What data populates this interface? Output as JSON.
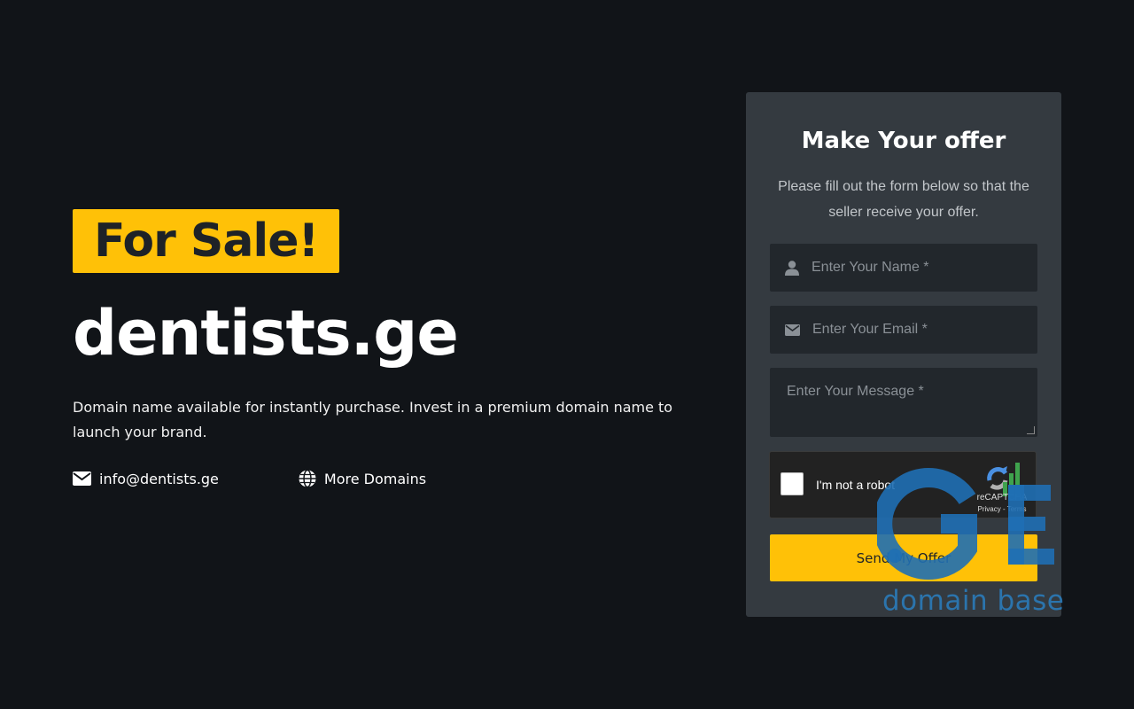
{
  "hero": {
    "badge": "For Sale!",
    "domain": "dentists.ge",
    "description": "Domain name available for instantly purchase. Invest in a premium domain name to launch your brand.",
    "email_link": "info@dentists.ge",
    "more_domains_link": "More Domains"
  },
  "offer_form": {
    "title": "Make Your offer",
    "subtitle": "Please fill out the form below so that the seller receive your offer.",
    "name_placeholder": "Enter Your Name *",
    "email_placeholder": "Enter Your Email *",
    "message_placeholder": "Enter Your Message *",
    "captcha": {
      "label": "I'm not a robot",
      "brand": "reCAPTCHA",
      "terms": "Privacy - Terms"
    },
    "submit_label": "Send My Offer"
  },
  "watermark": {
    "text": "domain base",
    "logo_letters": "GE"
  },
  "colors": {
    "background": "#111418",
    "accent": "#ffc107",
    "card": "#343a40",
    "input": "#22272c",
    "watermark": "#2a7fc0"
  }
}
